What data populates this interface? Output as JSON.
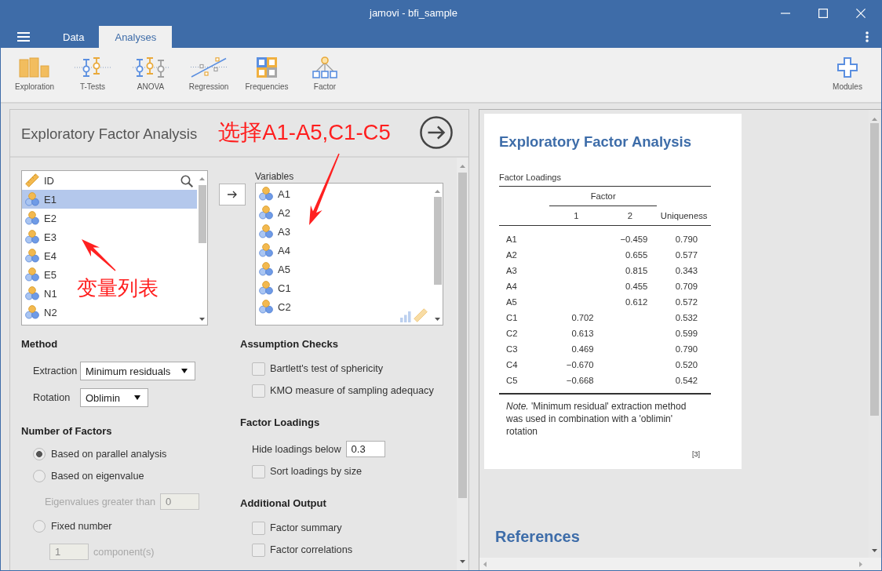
{
  "window": {
    "title": "jamovi - bfi_sample"
  },
  "tabs": [
    {
      "label": "Data",
      "selected": false
    },
    {
      "label": "Analyses",
      "selected": true
    }
  ],
  "ribbon": {
    "items": [
      {
        "kind": "exploration",
        "label": "Exploration"
      },
      {
        "kind": "t_tests",
        "label": "T-Tests"
      },
      {
        "kind": "anova",
        "label": "ANOVA"
      },
      {
        "kind": "regression",
        "label": "Regression"
      },
      {
        "kind": "frequencies",
        "label": "Frequencies"
      },
      {
        "kind": "factor",
        "label": "Factor"
      }
    ],
    "modules": {
      "label": "Modules"
    }
  },
  "analysis": {
    "title": "Exploratory Factor Analysis",
    "annotation": "选择A1-A5,C1-C5",
    "list_annotation": "变量列表",
    "source_variables": [
      {
        "name": "ID",
        "kind": "continuous",
        "selected": false
      },
      {
        "name": "E1",
        "kind": "nominal",
        "selected": true
      },
      {
        "name": "E2",
        "kind": "nominal",
        "selected": false
      },
      {
        "name": "E3",
        "kind": "nominal",
        "selected": false
      },
      {
        "name": "E4",
        "kind": "nominal",
        "selected": false
      },
      {
        "name": "E5",
        "kind": "nominal",
        "selected": false
      },
      {
        "name": "N1",
        "kind": "nominal",
        "selected": false
      },
      {
        "name": "N2",
        "kind": "nominal",
        "selected": false
      }
    ],
    "target": {
      "label": "Variables",
      "items": [
        {
          "name": "A1",
          "kind": "nominal",
          "selected": false
        },
        {
          "name": "A2",
          "kind": "nominal",
          "selected": false
        },
        {
          "name": "A3",
          "kind": "nominal",
          "selected": false
        },
        {
          "name": "A4",
          "kind": "nominal",
          "selected": false
        },
        {
          "name": "A5",
          "kind": "nominal",
          "selected": false
        },
        {
          "name": "C1",
          "kind": "nominal",
          "selected": false
        },
        {
          "name": "C2",
          "kind": "nominal",
          "selected": false
        }
      ]
    },
    "method": {
      "heading": "Method",
      "fields": [
        {
          "label": "Extraction",
          "value": "Minimum residuals"
        },
        {
          "label": "Rotation",
          "value": "Oblimin"
        }
      ]
    },
    "number_of_factors": {
      "heading": "Number of Factors",
      "options": [
        {
          "label": "Based on parallel analysis",
          "selected": true
        },
        {
          "label": "Based on eigenvalue",
          "selected": false,
          "field": {
            "label": "Eigenvalues greater than",
            "value": "0",
            "disabled": true
          }
        },
        {
          "label": "Fixed number",
          "selected": false,
          "field": {
            "value": "1",
            "suffix": "component(s)",
            "disabled": true
          }
        }
      ]
    },
    "assumption_checks": {
      "heading": "Assumption Checks",
      "options": [
        {
          "label": "Bartlett's test of sphericity",
          "checked": false
        },
        {
          "label": "KMO measure of sampling adequacy",
          "checked": false
        }
      ]
    },
    "factor_loadings": {
      "heading": "Factor Loadings",
      "threshold": {
        "label": "Hide loadings below",
        "value": "0.3"
      },
      "options": [
        {
          "label": "Sort loadings by size",
          "checked": false
        }
      ]
    },
    "additional_output": {
      "heading": "Additional Output",
      "options": [
        {
          "label": "Factor summary",
          "checked": false
        },
        {
          "label": "Factor correlations",
          "checked": false
        }
      ]
    }
  },
  "results": {
    "title": "Exploratory Factor Analysis",
    "table": {
      "title": "Factor Loadings",
      "group_header": "Factor",
      "column_headers": {
        "factor_1": "1",
        "factor_2": "2",
        "uniqueness": "Uniqueness"
      },
      "rows": [
        {
          "name": "A1",
          "factor_2": "−0.459",
          "uniqueness": "0.790"
        },
        {
          "name": "A2",
          "factor_2": "0.655",
          "uniqueness": "0.577"
        },
        {
          "name": "A3",
          "factor_2": "0.815",
          "uniqueness": "0.343"
        },
        {
          "name": "A4",
          "factor_2": "0.455",
          "uniqueness": "0.709"
        },
        {
          "name": "A5",
          "factor_2": "0.612",
          "uniqueness": "0.572"
        },
        {
          "name": "C1",
          "factor_1": "0.702",
          "uniqueness": "0.532"
        },
        {
          "name": "C2",
          "factor_1": "0.613",
          "uniqueness": "0.599"
        },
        {
          "name": "C3",
          "factor_1": "0.469",
          "uniqueness": "0.790"
        },
        {
          "name": "C4",
          "factor_1": "−0.670",
          "uniqueness": "0.520"
        },
        {
          "name": "C5",
          "factor_1": "−0.668",
          "uniqueness": "0.542"
        }
      ]
    },
    "note": "*Note.* 'Minimum residual' extraction method was used in combination with a 'oblimin' rotation",
    "reference": "[3]"
  },
  "references": {
    "heading": "References"
  }
}
